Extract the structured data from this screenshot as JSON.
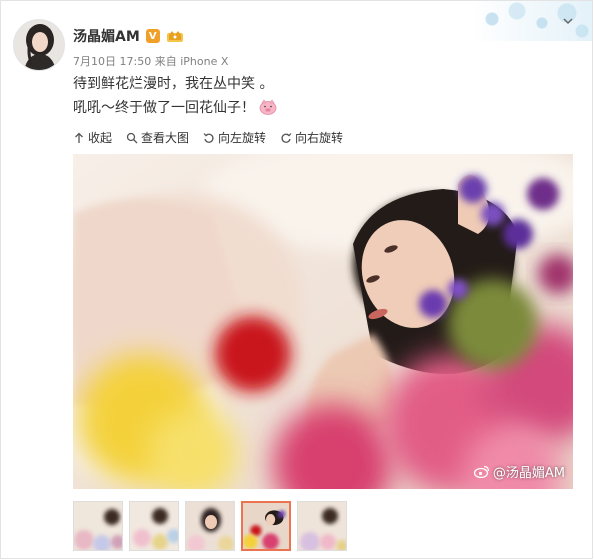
{
  "post": {
    "author": "汤晶媚AM",
    "verified_badge": "V",
    "date": "7月10日 17:50",
    "source_prefix": "来自",
    "source": "iPhone X",
    "text_line1": "待到鲜花烂漫时，我在丛中笑 。",
    "text_line2": "吼吼～终于做了一回花仙子！"
  },
  "toolbar": {
    "collapse": "收起",
    "view_large": "查看大图",
    "rotate_left": "向左旋转",
    "rotate_right": "向右旋转"
  },
  "watermark": "@汤晶媚AM",
  "thumbnails": [
    "1",
    "2",
    "3",
    "4",
    "5"
  ],
  "active_thumbnail": 4,
  "colors": {
    "accent": "#eb7350",
    "badge": "#f0a028",
    "meta_text": "#808080"
  }
}
